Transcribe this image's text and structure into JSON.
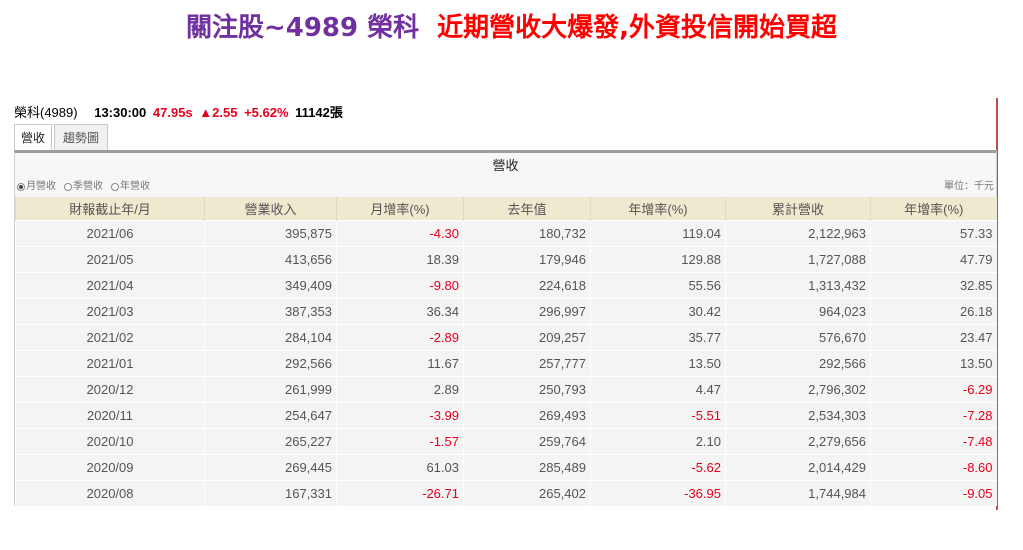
{
  "headline": {
    "part1": "關注股~4989 榮科",
    "part2": "近期營收大爆發,外資投信開始買超"
  },
  "stock": {
    "name": "榮科(4989)",
    "time": "13:30:00",
    "price": "47.95s",
    "change": "▲2.55",
    "percent": "+5.62%",
    "volume": "11142張"
  },
  "tabs": [
    {
      "label": "營收",
      "active": true
    },
    {
      "label": "趨勢圖",
      "active": false
    }
  ],
  "panel": {
    "title": "營收",
    "options": [
      {
        "label": "月營收",
        "selected": true
      },
      {
        "label": "季營收",
        "selected": false
      },
      {
        "label": "年營收",
        "selected": false
      }
    ],
    "unit": "單位：千元"
  },
  "table": {
    "headers": [
      "財報截止年/月",
      "營業收入",
      "月增率(%)",
      "去年值",
      "年增率(%)",
      "累計營收",
      "年增率(%)"
    ],
    "rows": [
      [
        "2021/06",
        "395,875",
        "-4.30",
        "180,732",
        "119.04",
        "2,122,963",
        "57.33"
      ],
      [
        "2021/05",
        "413,656",
        "18.39",
        "179,946",
        "129.88",
        "1,727,088",
        "47.79"
      ],
      [
        "2021/04",
        "349,409",
        "-9.80",
        "224,618",
        "55.56",
        "1,313,432",
        "32.85"
      ],
      [
        "2021/03",
        "387,353",
        "36.34",
        "296,997",
        "30.42",
        "964,023",
        "26.18"
      ],
      [
        "2021/02",
        "284,104",
        "-2.89",
        "209,257",
        "35.77",
        "576,670",
        "23.47"
      ],
      [
        "2021/01",
        "292,566",
        "11.67",
        "257,777",
        "13.50",
        "292,566",
        "13.50"
      ],
      [
        "2020/12",
        "261,999",
        "2.89",
        "250,793",
        "4.47",
        "2,796,302",
        "-6.29"
      ],
      [
        "2020/11",
        "254,647",
        "-3.99",
        "269,493",
        "-5.51",
        "2,534,303",
        "-7.28"
      ],
      [
        "2020/10",
        "265,227",
        "-1.57",
        "259,764",
        "2.10",
        "2,279,656",
        "-7.48"
      ],
      [
        "2020/09",
        "269,445",
        "61.03",
        "285,489",
        "-5.62",
        "2,014,429",
        "-8.60"
      ],
      [
        "2020/08",
        "167,331",
        "-26.71",
        "265,402",
        "-36.95",
        "1,744,984",
        "-9.05"
      ]
    ]
  },
  "colors": {
    "headline_purple": "#7030a0",
    "headline_red": "#ff0000",
    "negative_red": "#e8001c",
    "header_bg": "#efe9cf"
  }
}
